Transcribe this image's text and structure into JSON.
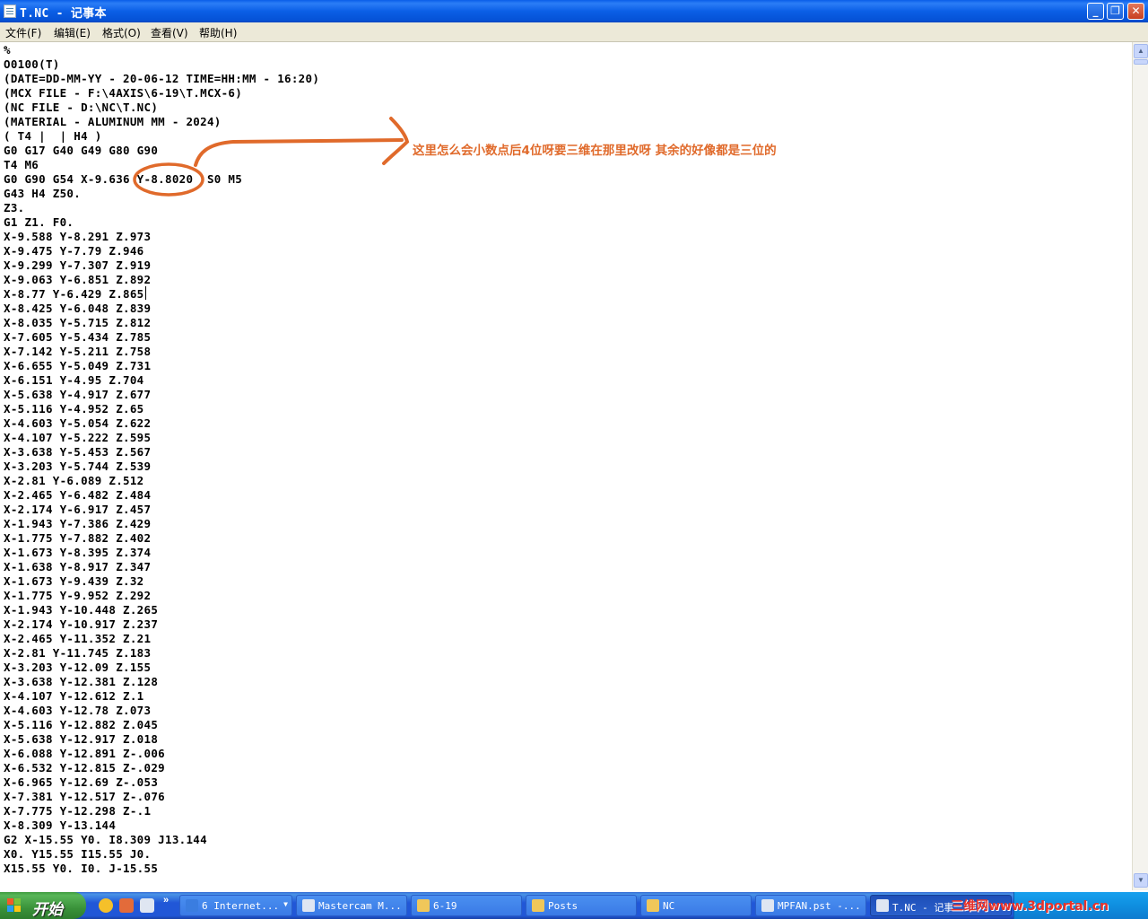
{
  "window": {
    "title": "T.NC - 记事本",
    "min_glyph": "_",
    "max_glyph": "❐",
    "close_glyph": "✕"
  },
  "menu": [
    "文件(F)",
    "编辑(E)",
    "格式(O)",
    "查看(V)",
    "帮助(H)"
  ],
  "content": {
    "lines": [
      "%",
      "O0100(T)",
      "(DATE=DD-MM-YY - 20-06-12 TIME=HH:MM - 16:20)",
      "(MCX FILE - F:\\4AXIS\\6-19\\T.MCX-6)",
      "(NC FILE - D:\\NC\\T.NC)",
      "(MATERIAL - ALUMINUM MM - 2024)",
      "( T4 |  | H4 )",
      "G0 G17 G40 G49 G80 G90",
      "T4 M6",
      "G0 G90 G54 X-9.636 Y-8.8020  S0 M5",
      "G43 H4 Z50.",
      "Z3.",
      "G1 Z1. F0.",
      "X-9.588 Y-8.291 Z.973",
      "X-9.475 Y-7.79 Z.946",
      "X-9.299 Y-7.307 Z.919",
      "X-9.063 Y-6.851 Z.892",
      "X-8.77 Y-6.429 Z.865",
      "X-8.425 Y-6.048 Z.839",
      "X-8.035 Y-5.715 Z.812",
      "X-7.605 Y-5.434 Z.785",
      "X-7.142 Y-5.211 Z.758",
      "X-6.655 Y-5.049 Z.731",
      "X-6.151 Y-4.95 Z.704",
      "X-5.638 Y-4.917 Z.677",
      "X-5.116 Y-4.952 Z.65",
      "X-4.603 Y-5.054 Z.622",
      "X-4.107 Y-5.222 Z.595",
      "X-3.638 Y-5.453 Z.567",
      "X-3.203 Y-5.744 Z.539",
      "X-2.81 Y-6.089 Z.512",
      "X-2.465 Y-6.482 Z.484",
      "X-2.174 Y-6.917 Z.457",
      "X-1.943 Y-7.386 Z.429",
      "X-1.775 Y-7.882 Z.402",
      "X-1.673 Y-8.395 Z.374",
      "X-1.638 Y-8.917 Z.347",
      "X-1.673 Y-9.439 Z.32",
      "X-1.775 Y-9.952 Z.292",
      "X-1.943 Y-10.448 Z.265",
      "X-2.174 Y-10.917 Z.237",
      "X-2.465 Y-11.352 Z.21",
      "X-2.81 Y-11.745 Z.183",
      "X-3.203 Y-12.09 Z.155",
      "X-3.638 Y-12.381 Z.128",
      "X-4.107 Y-12.612 Z.1",
      "X-4.603 Y-12.78 Z.073",
      "X-5.116 Y-12.882 Z.045",
      "X-5.638 Y-12.917 Z.018",
      "X-6.088 Y-12.891 Z-.006",
      "X-6.532 Y-12.815 Z-.029",
      "X-6.965 Y-12.69 Z-.053",
      "X-7.381 Y-12.517 Z-.076",
      "X-7.775 Y-12.298 Z-.1",
      "X-8.309 Y-13.144",
      "G2 X-15.55 Y0. I8.309 J13.144",
      "X0. Y15.55 I15.55 J0.",
      "X15.55 Y0. I0. J-15.55"
    ]
  },
  "annotation": {
    "text": "这里怎么会小数点后4位呀要三维在那里改呀 其余的好像都是三位的",
    "color": "#e06a2b"
  },
  "taskbar": {
    "start_label": "开始",
    "quick_more": "»",
    "tasks": [
      {
        "label": "6 Internet...",
        "icon_color": "#3a7de0",
        "arrow": "▼",
        "active": false
      },
      {
        "label": "Mastercam M...",
        "icon_color": "#dfe6f2",
        "arrow": "",
        "active": false
      },
      {
        "label": "6-19",
        "icon_color": "#f0c75a",
        "arrow": "",
        "active": false
      },
      {
        "label": "Posts",
        "icon_color": "#f0c75a",
        "arrow": "",
        "active": false
      },
      {
        "label": "NC",
        "icon_color": "#f0c75a",
        "arrow": "",
        "active": false
      },
      {
        "label": "MPFAN.pst -...",
        "icon_color": "#dfe6f2",
        "arrow": "",
        "active": false
      },
      {
        "label": "T.NC - 记事",
        "icon_color": "#dfe6f2",
        "arrow": "",
        "active": true
      }
    ],
    "watermark": "三维网www.3dportal.cn"
  }
}
